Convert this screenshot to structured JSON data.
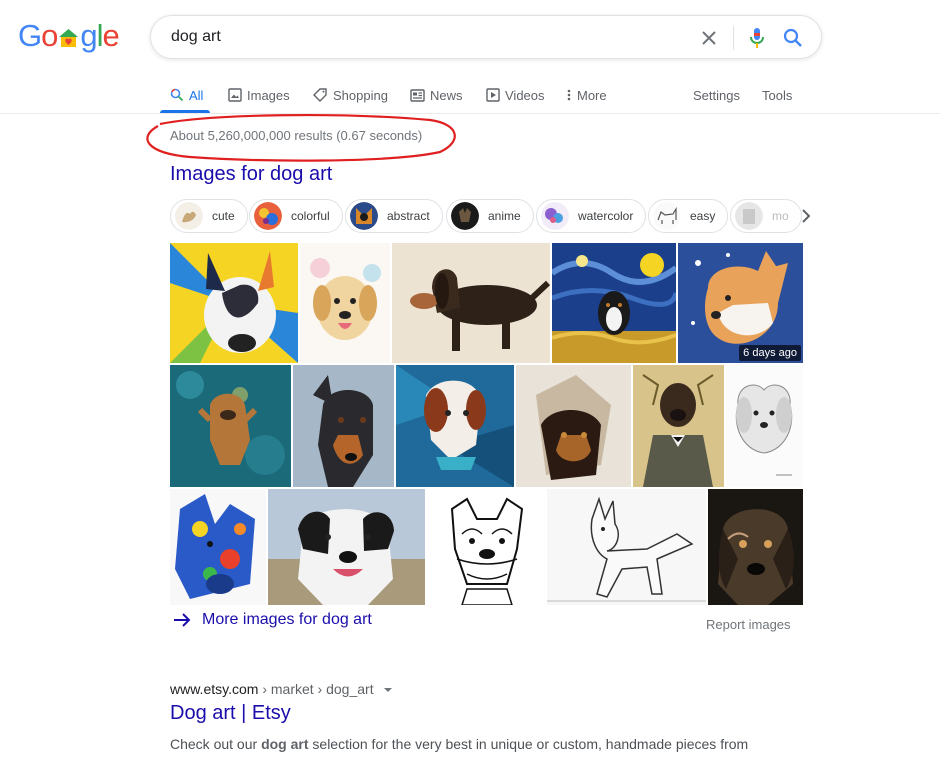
{
  "logo": {
    "letters": [
      "G",
      "o",
      "",
      "g",
      "l",
      "e"
    ]
  },
  "search": {
    "query": "dog art"
  },
  "tabs": {
    "all": "All",
    "images": "Images",
    "shopping": "Shopping",
    "news": "News",
    "videos": "Videos",
    "more": "More",
    "settings": "Settings",
    "tools": "Tools"
  },
  "results_stats": "About 5,260,000,000 results (0.67 seconds)",
  "images_section": {
    "heading": "Images for dog art",
    "chips": [
      "cute",
      "colorful",
      "abstract",
      "anime",
      "watercolor",
      "easy",
      "mo"
    ],
    "badge": "6 days ago",
    "more_link": "More images for dog art",
    "report": "Report images"
  },
  "result": {
    "domain": "www.etsy.com",
    "breadcrumb": "› market › dog_art",
    "title": "Dog art | Etsy",
    "snippet_before": "Check out our ",
    "snippet_bold": "dog art",
    "snippet_after": " selection for the very best in unique or custom, handmade pieces from"
  },
  "colors": {
    "link": "#1a0dab",
    "accent": "#1a73e8",
    "annotation": "#e02020"
  }
}
